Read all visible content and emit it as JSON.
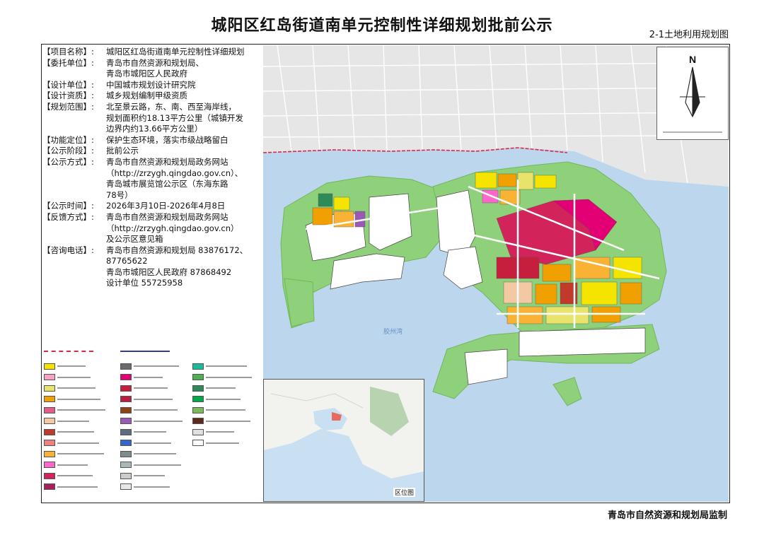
{
  "title": "城阳区红岛街道南单元控制性详细规划批前公示",
  "sheet_label": "2-1土地利用规划图",
  "footer": "青岛市自然资源和规划局监制",
  "info": [
    {
      "key": "【项目名称】:",
      "value": "城阳区红岛街道南单元控制性详细规划"
    },
    {
      "key": "【委托单位】:",
      "value": "青岛市自然资源和规划局、\n青岛市城阳区人民政府"
    },
    {
      "key": "【设计单位】:",
      "value": "中国城市规划设计研究院"
    },
    {
      "key": "【设计资质】:",
      "value": "城乡规划编制甲级资质"
    },
    {
      "key": "【规划范围】:",
      "value": "北至景云路，东、南、西至海岸线，\n规划面积约18.13平方公里（城镇开发\n边界内约13.66平方公里）"
    },
    {
      "key": "【功能定位】:",
      "value": "保护生态环境，落实市级战略留白"
    },
    {
      "key": "【公示阶段】:",
      "value": "批前公示"
    },
    {
      "key": "【公示方式】:",
      "value": "青岛市自然资源和规划局政务网站\n（http://zrzygh.qingdao.gov.cn）、\n青岛城市展览馆公示区（东海东路\n78号）"
    },
    {
      "key": "【公示时间】:",
      "value": "2026年3月10日-2026年4月8日"
    },
    {
      "key": "【反馈方式】:",
      "value": "青岛市自然资源和规划局政务网站\n（http://zrzygh.qingdao.gov.cn）\n及公示区意见箱"
    },
    {
      "key": "【咨询电话】:",
      "value": "青岛市自然资源和规划局   83876172、\n                                   87765622\n青岛市城阳区人民政府       87868492\n设计单位                       55725958"
    }
  ],
  "compass": {
    "letter": "N"
  },
  "bay_label": "胶州湾",
  "inset_label": "区位图",
  "legend": {
    "colors": [
      "#f5e400",
      "#f7a1c4",
      "#e8e36a",
      "#f0a000",
      "#e85a8a",
      "#f3c9a4",
      "#c0392b",
      "#f08080",
      "#f9b233",
      "#ff66cc",
      "#d2235b",
      "#ab1f5e",
      "#6a6a6a",
      "#e20074",
      "#c51f3d",
      "#bb1e3c",
      "#8b4513",
      "#9b59b6",
      "#5d6d7e",
      "#3366cc",
      "#7f8c8d",
      "#aab7b8",
      "#cccccc",
      "#e5e7e9",
      "#1abc9c",
      "#4caf50",
      "#2e8b57",
      "#00aa44",
      "#7cbb5c",
      "#5c2a1f",
      "#e0e0e0",
      "#ffffff"
    ]
  }
}
